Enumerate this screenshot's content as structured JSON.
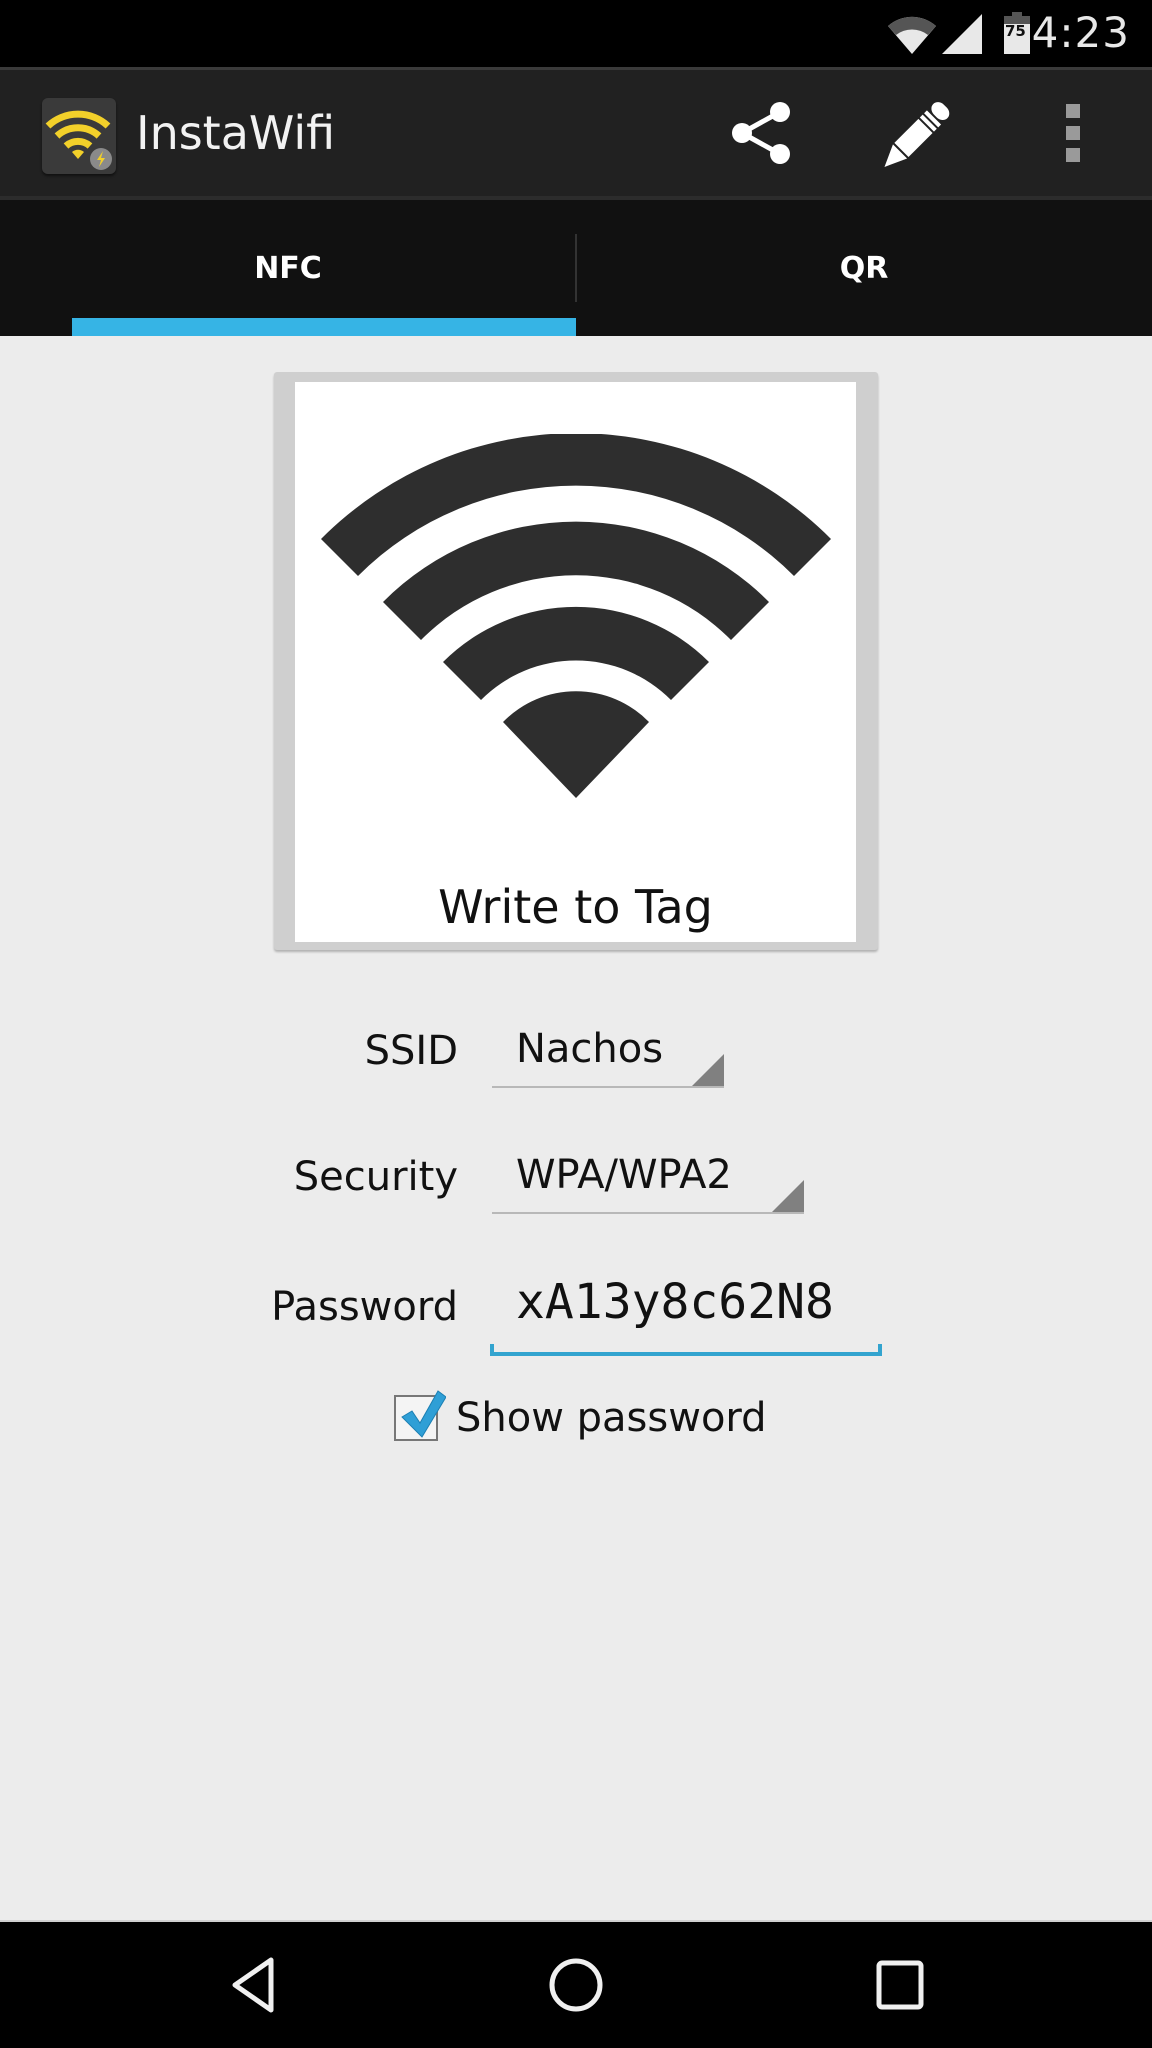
{
  "status_bar": {
    "time": "4:23",
    "battery_level": "75",
    "icons": [
      "wifi-icon",
      "cell-signal-icon",
      "battery-icon"
    ]
  },
  "action_bar": {
    "title": "InstaWifi",
    "icons": [
      "app-logo-icon",
      "share-icon",
      "edit-pencil-icon",
      "overflow-menu-icon"
    ]
  },
  "tabs": [
    {
      "label": "NFC",
      "selected": true
    },
    {
      "label": "QR",
      "selected": false
    }
  ],
  "colors": {
    "accent": "#36b4e5",
    "action_bar_bg": "#212121",
    "tab_bar_bg": "#111111",
    "content_bg": "#ececec",
    "app_icon_yellow": "#f2d02a"
  },
  "card": {
    "icon": "wifi-large-icon",
    "label": "Write to Tag"
  },
  "form": {
    "ssid": {
      "label": "SSID",
      "value": "Nachos"
    },
    "security": {
      "label": "Security",
      "value": "WPA/WPA2"
    },
    "password": {
      "label": "Password",
      "value": "xA13y8c62N8"
    },
    "show_password": {
      "label": "Show password",
      "checked": true
    }
  },
  "nav_bar": {
    "icons": [
      "back-icon",
      "home-icon",
      "recents-icon"
    ]
  }
}
